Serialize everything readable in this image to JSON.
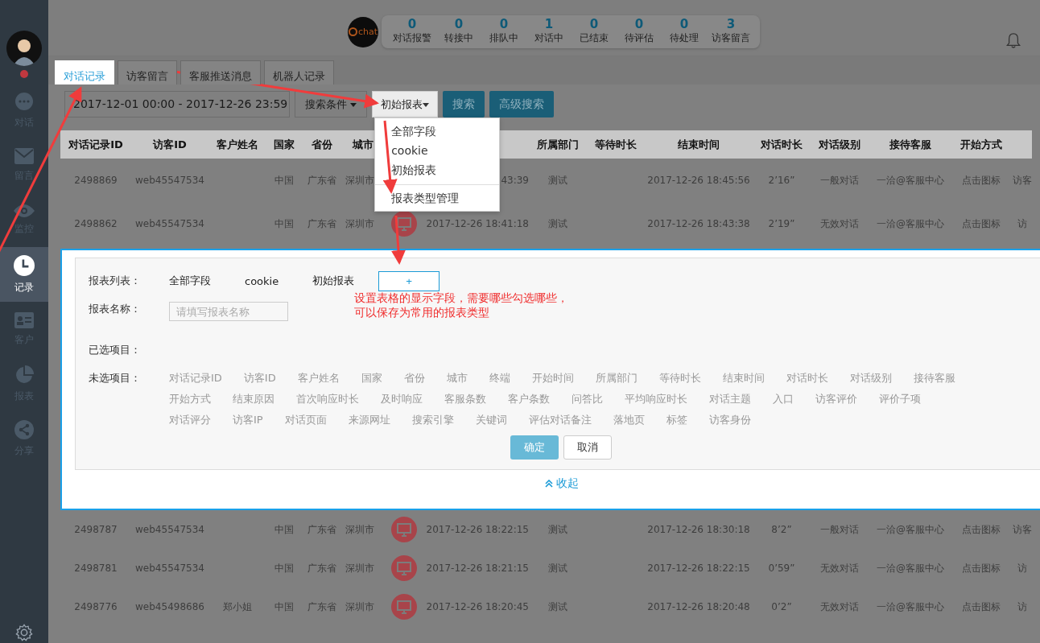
{
  "window": {
    "logo_text": "chat"
  },
  "sidebar": {
    "items": [
      {
        "label": "对话",
        "selected": false
      },
      {
        "label": "留言",
        "selected": false
      },
      {
        "label": "监控",
        "selected": false
      },
      {
        "label": "记录",
        "selected": true
      },
      {
        "label": "客户",
        "selected": false
      },
      {
        "label": "报表",
        "selected": false
      },
      {
        "label": "分享",
        "selected": false
      }
    ]
  },
  "stats": [
    {
      "value": "0",
      "label": "对话报警"
    },
    {
      "value": "0",
      "label": "转接中"
    },
    {
      "value": "0",
      "label": "排队中"
    },
    {
      "value": "1",
      "label": "对话中"
    },
    {
      "value": "0",
      "label": "已结束"
    },
    {
      "value": "0",
      "label": "待评估"
    },
    {
      "value": "0",
      "label": "待处理"
    },
    {
      "value": "3",
      "label": "访客留言"
    }
  ],
  "tabs": [
    {
      "label": "对话记录",
      "selected": true
    },
    {
      "label": "访客留言",
      "selected": false
    },
    {
      "label": "客服推送消息",
      "selected": false
    },
    {
      "label": "机器人记录",
      "selected": false
    }
  ],
  "toolbar": {
    "date_range": "2017-12-01 00:00  -  2017-12-26 23:59",
    "filter_button": "搜索条件",
    "report_button": "初始报表",
    "search_button": "搜索",
    "advanced_button": "高级搜索"
  },
  "report_menu": {
    "items": [
      "全部字段",
      "cookie",
      "初始报表"
    ],
    "manage_item": "报表类型管理"
  },
  "table": {
    "columns": [
      "对话记录ID",
      "访客ID",
      "客户姓名",
      "国家",
      "省份",
      "城市",
      "所属部门",
      "等待时长",
      "结束时间",
      "对话时长",
      "对话级别",
      "接待客服",
      "开始方式"
    ],
    "rows": [
      {
        "id": "2498869",
        "visitor_id": "web45547534",
        "country": "中国",
        "province": "广东省",
        "city": "深圳市",
        "terminal_icon": false,
        "start_time": "43:39",
        "department": "测试",
        "end_time": "2017-12-26 18:45:56",
        "duration": "2’16”",
        "level": "一般对话",
        "agent": "一洽@客服中心",
        "start_mode": "点击图标",
        "column_16": "访客"
      },
      {
        "id": "2498862",
        "visitor_id": "web45547534",
        "country": "中国",
        "province": "广东省",
        "city": "深圳市",
        "terminal_icon": true,
        "start_time": "2017-12-26 18:41:18",
        "department": "测试",
        "end_time": "2017-12-26 18:43:38",
        "duration": "2’19”",
        "level": "无效对话",
        "agent": "一洽@客服中心",
        "start_mode": "点击图标",
        "column_16": "访"
      },
      {
        "id": "2498787",
        "visitor_id": "web45547534",
        "country": "中国",
        "province": "广东省",
        "city": "深圳市",
        "terminal_icon": true,
        "start_time": "2017-12-26 18:22:15",
        "department": "测试",
        "end_time": "2017-12-26 18:30:18",
        "duration": "8’2”",
        "level": "一般对话",
        "agent": "一洽@客服中心",
        "start_mode": "点击图标",
        "column_16": "访客"
      },
      {
        "id": "2498781",
        "visitor_id": "web45547534",
        "country": "中国",
        "province": "广东省",
        "city": "深圳市",
        "terminal_icon": true,
        "start_time": "2017-12-26 18:21:15",
        "department": "测试",
        "end_time": "2017-12-26 18:22:15",
        "duration": "0’59”",
        "level": "无效对话",
        "agent": "一洽@客服中心",
        "start_mode": "点击图标",
        "column_16": "访"
      },
      {
        "id": "2498776",
        "visitor_id": "web45498686",
        "customer_name": "郑小姐",
        "country": "中国",
        "province": "广东省",
        "city": "深圳市",
        "terminal_icon": true,
        "start_time": "2017-12-26 18:20:45",
        "department": "测试",
        "end_time": "2017-12-26 18:20:48",
        "duration": "0’2”",
        "level": "无效对话",
        "agent": "一洽@客服中心",
        "start_mode": "点击图标",
        "column_16": "访"
      }
    ]
  },
  "report_panel": {
    "list_label": "报表列表：",
    "reports": [
      "全部字段",
      "cookie",
      "初始报表"
    ],
    "add_button": "+",
    "annotation_lines": [
      "设置表格的显示字段，需要哪些勾选哪些，",
      "可以保存为常用的报表类型"
    ],
    "name_label": "报表名称：",
    "name_placeholder": "请填写报表名称",
    "selected_label": "已选项目：",
    "unselected_label": "未选项目：",
    "unselected_fields": [
      "对话记录ID",
      "访客ID",
      "客户姓名",
      "国家",
      "省份",
      "城市",
      "终端",
      "开始时间",
      "所属部门",
      "等待时长",
      "结束时间",
      "对话时长",
      "对话级别",
      "接待客服",
      "开始方式",
      "结束原因",
      "首次响应时长",
      "及时响应",
      "客服条数",
      "客户条数",
      "问答比",
      "平均响应时长",
      "对话主题",
      "入口",
      "访客评价",
      "评价子项",
      "对话评分",
      "访客IP",
      "对话页面",
      "来源网址",
      "搜索引擎",
      "关键词",
      "评估对话备注",
      "落地页",
      "标签",
      "访客身份"
    ],
    "confirm_button": "确定",
    "cancel_button": "取消",
    "collapse_link": "收起"
  }
}
